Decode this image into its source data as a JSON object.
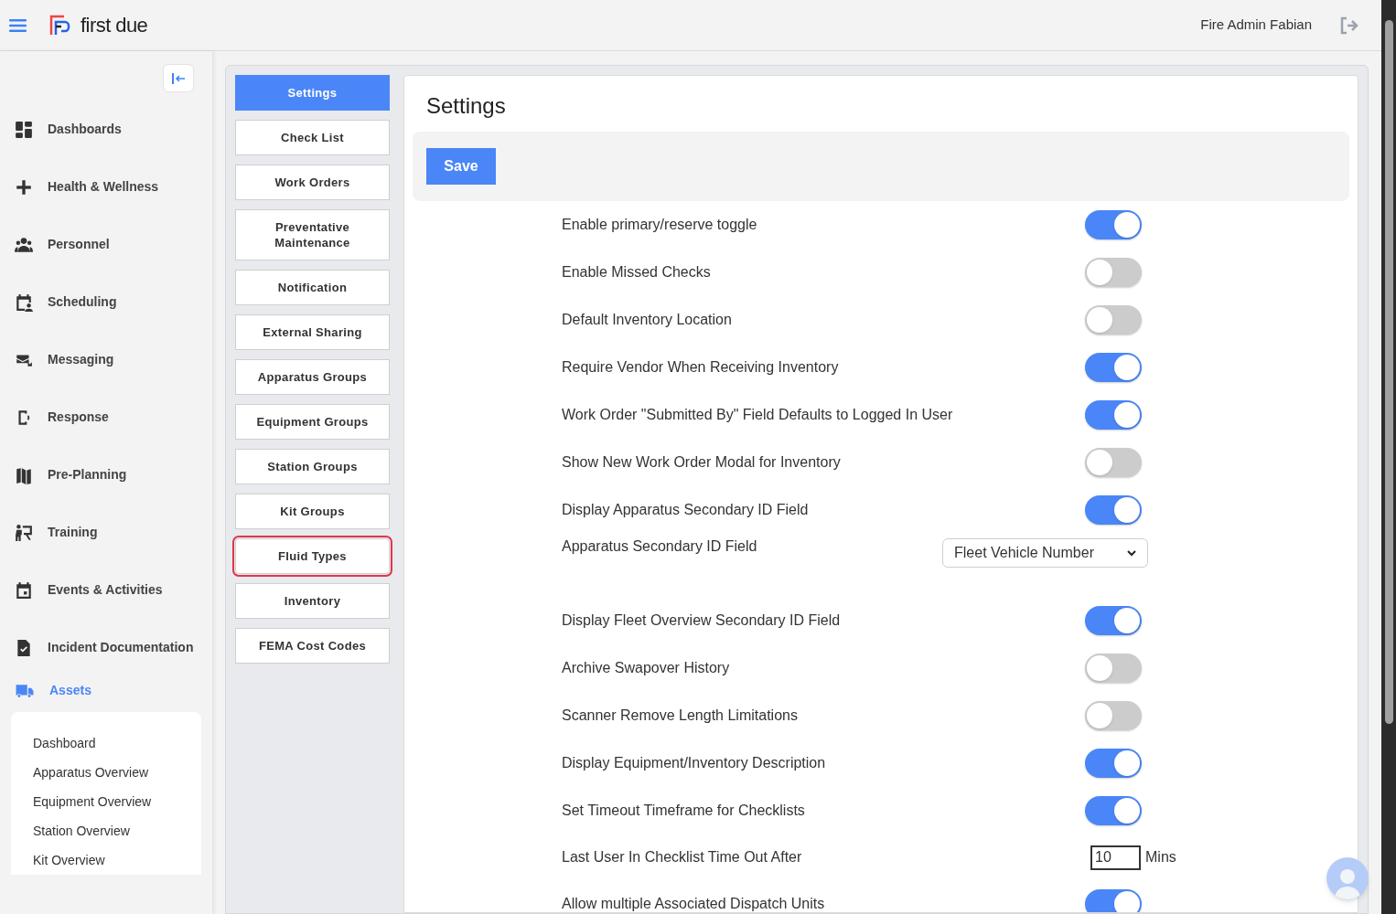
{
  "header": {
    "brand": "first due",
    "user": "Fire Admin Fabian"
  },
  "sidebar": {
    "items": [
      {
        "label": "Dashboards",
        "selected": false
      },
      {
        "label": "Health & Wellness",
        "selected": false
      },
      {
        "label": "Personnel",
        "selected": false
      },
      {
        "label": "Scheduling",
        "selected": false
      },
      {
        "label": "Messaging",
        "selected": false
      },
      {
        "label": "Response",
        "selected": false
      },
      {
        "label": "Pre-Planning",
        "selected": false
      },
      {
        "label": "Training",
        "selected": false
      },
      {
        "label": "Events & Activities",
        "selected": false
      },
      {
        "label": "Incident Documentation",
        "selected": false
      },
      {
        "label": "Assets",
        "selected": true,
        "children": [
          "Dashboard",
          "Apparatus Overview",
          "Equipment Overview",
          "Station Overview",
          "Kit Overview"
        ]
      }
    ]
  },
  "subnav": [
    {
      "label": "Settings",
      "selected": true,
      "focused": false
    },
    {
      "label": "Check List",
      "selected": false,
      "focused": false
    },
    {
      "label": "Work Orders",
      "selected": false,
      "focused": false
    },
    {
      "label": "Preventative Maintenance",
      "selected": false,
      "focused": false
    },
    {
      "label": "Notification",
      "selected": false,
      "focused": false
    },
    {
      "label": "External Sharing",
      "selected": false,
      "focused": false
    },
    {
      "label": "Apparatus Groups",
      "selected": false,
      "focused": false
    },
    {
      "label": "Equipment Groups",
      "selected": false,
      "focused": false
    },
    {
      "label": "Station Groups",
      "selected": false,
      "focused": false
    },
    {
      "label": "Kit Groups",
      "selected": false,
      "focused": false
    },
    {
      "label": "Fluid Types",
      "selected": false,
      "focused": true
    },
    {
      "label": "Inventory",
      "selected": false,
      "focused": false
    },
    {
      "label": "FEMA Cost Codes",
      "selected": false,
      "focused": false
    }
  ],
  "main": {
    "title": "Settings",
    "save_button": "Save",
    "settings": [
      {
        "kind": "toggle",
        "label": "Enable primary/reserve toggle",
        "on": true
      },
      {
        "kind": "toggle",
        "label": "Enable Missed Checks",
        "on": false
      },
      {
        "kind": "toggle",
        "label": "Default Inventory Location",
        "on": false
      },
      {
        "kind": "toggle",
        "label": "Require Vendor When Receiving Inventory",
        "on": true
      },
      {
        "kind": "toggle",
        "label": "Work Order \"Submitted By\" Field Defaults to Logged In User",
        "on": true
      },
      {
        "kind": "toggle",
        "label": "Show New Work Order Modal for Inventory",
        "on": false
      },
      {
        "kind": "toggle",
        "label": "Display Apparatus Secondary ID Field",
        "on": true
      },
      {
        "kind": "select",
        "label": "Apparatus Secondary ID Field",
        "value": "Fleet Vehicle Number"
      },
      {
        "kind": "toggle",
        "label": "Display Fleet Overview Secondary ID Field",
        "on": true
      },
      {
        "kind": "toggle",
        "label": "Archive Swapover History",
        "on": false
      },
      {
        "kind": "toggle",
        "label": "Scanner Remove Length Limitations",
        "on": false
      },
      {
        "kind": "toggle",
        "label": "Display Equipment/Inventory Description",
        "on": true
      },
      {
        "kind": "toggle",
        "label": "Set Timeout Timeframe for Checklists",
        "on": true
      },
      {
        "kind": "number",
        "label": "Last User In Checklist Time Out After",
        "value": "10",
        "unit": "Mins"
      },
      {
        "kind": "toggle",
        "label": "Allow multiple Associated Dispatch Units",
        "on": true
      }
    ]
  }
}
